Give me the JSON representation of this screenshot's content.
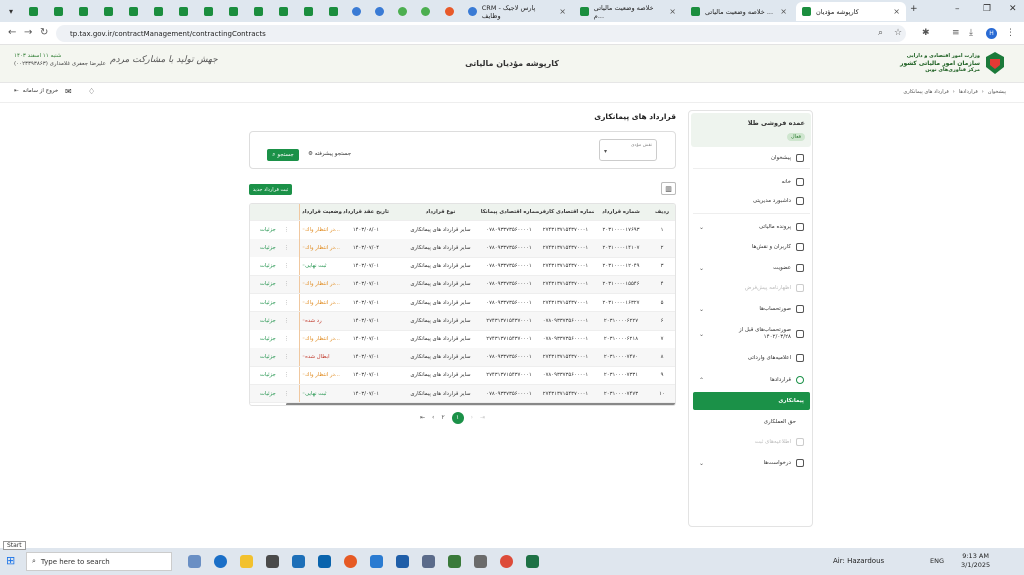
{
  "browser": {
    "tabs": [
      {
        "title": "CRM پارس لاجیک - وظایف",
        "icon": "task-icon"
      },
      {
        "title": "خلاصه وضعیت مالیاتی م...",
        "icon": "tax-icon"
      },
      {
        "title": "خلاصه وضعیت مالیاتی ...",
        "icon": "tax-icon"
      },
      {
        "title": "کارپوشه مؤدیان",
        "icon": "tax-icon",
        "active": true
      }
    ],
    "url": "tp.tax.gov.ir/contractManagement/contractingContracts",
    "profile": "H"
  },
  "header": {
    "title": "کارپوشه مؤدیان مالیاتی",
    "logo_line1": "وزارت امور اقتصادی و دارایی",
    "logo_line2": "سازمان امور مالیاتی کشور",
    "logo_line3": "مرکز فناوری‌های نوین",
    "slogan": "جهش تولید با مشارکت مردم",
    "date": "شنبه ۱۱ اسفند ۱۴۰۳",
    "user": "علیرضا جعفری غلامداری (۰۰۲۳۳۹۳۸۶۳)"
  },
  "toolbar": {
    "exit": "خروج از سامانه",
    "breadcrumb": [
      "پیشخوان",
      "قراردادها",
      "قرارداد های پیمانکاری"
    ]
  },
  "sidebar": {
    "company": "عمده فروشی طلا",
    "status": "فعال",
    "items": [
      {
        "label": "پیشخوان",
        "icon": "dashboard-icon"
      },
      {
        "label": "خانه",
        "icon": "home-icon"
      },
      {
        "label": "داشبورد مدیریتی",
        "icon": "chart-icon"
      },
      {
        "label": "پرونده مالیاتی",
        "icon": "folder-icon"
      },
      {
        "label": "کاربران و نقش‌ها",
        "icon": "users-icon"
      },
      {
        "label": "عضویت",
        "icon": "user-icon"
      },
      {
        "label": "اظهارنامه پیش‌فرض",
        "icon": "form-icon",
        "disabled": true
      },
      {
        "label": "صورتحساب‌ها",
        "icon": "invoice-icon"
      },
      {
        "label": "صورتحساب‌های قبل از ۱۴۰۲/۰۳/۲۸",
        "icon": "invoice-icon"
      },
      {
        "label": "اعلامیه‌های وارداتی",
        "icon": "doc-icon"
      },
      {
        "label": "قراردادها",
        "icon": "contract-icon"
      },
      {
        "label": "پیمانکاری",
        "icon": "",
        "selected": true
      },
      {
        "label": "حق العملکاری",
        "icon": ""
      },
      {
        "label": "اطلاعیه‌های ثبت",
        "icon": "bell-icon",
        "disabled": true
      },
      {
        "label": "درخواست‌ها",
        "icon": "request-icon"
      }
    ]
  },
  "main": {
    "title": "قرارداد های پیمانکاری",
    "field_label": "نقش مؤدی",
    "search_btn": "جستجو",
    "advanced": "جستجو پیشرفته",
    "new_btn": "ثبت قرارداد جدید",
    "columns": [
      "ردیف",
      "شماره قرارداد",
      "شماره اقتصادی کارفرما",
      "شماره اقتصادی پیمانکار",
      "نوع قرارداد",
      "تاریخ عقد قرارداد",
      "وضعیت قرارداد"
    ],
    "details": "جزئیات",
    "rows": [
      {
        "n": "۱",
        "cn": "۲۰۳۱۰۰۰۰۱۷۶۹۳",
        "sid": "۲۷۴۳۱۳۷۱۵۴۳۷۰۰۰۱",
        "eid": "۰۷۸۰۹۳۳۷۳۵۶۰۰۰۰۱",
        "type": "سایر قرارداد های پیمانکاری",
        "date": "۱۴۰۳/۰۸/۰۱",
        "status": "در انتظار واك...",
        "sc": "w"
      },
      {
        "n": "۲",
        "cn": "۲۰۳۱۰۰۰۰۱۴۱۰۷",
        "sid": "۲۷۴۳۱۳۷۱۵۴۳۷۰۰۰۱",
        "eid": "۰۷۸۰۹۳۳۷۳۵۶۰۰۰۰۱",
        "type": "سایر قرارداد های پیمانکاری",
        "date": "۱۴۰۳/۰۷/۰۴",
        "status": "در انتظار واك...",
        "sc": "w"
      },
      {
        "n": "۳",
        "cn": "۲۰۳۱۰۰۰۰۱۲۰۴۹",
        "sid": "۲۷۴۳۱۳۷۱۵۴۳۷۰۰۰۱",
        "eid": "۰۷۸۰۹۳۳۷۳۵۶۰۰۰۰۱",
        "type": "سایر قرارداد های پیمانکاری",
        "date": "۱۴۰۳/۰۷/۰۱",
        "status": "ثبت نهایی",
        "sc": "f"
      },
      {
        "n": "۴",
        "cn": "۲۰۳۱۰۰۰۰۱۵۵۴۶",
        "sid": "۲۷۴۳۱۳۷۱۵۴۳۷۰۰۰۱",
        "eid": "۰۷۸۰۹۳۳۷۳۵۶۰۰۰۰۱",
        "type": "سایر قرارداد های پیمانکاری",
        "date": "۱۴۰۳/۰۷/۰۱",
        "status": "در انتظار واك...",
        "sc": "w"
      },
      {
        "n": "۵",
        "cn": "۲۰۳۱۰۰۰۰۱۶۳۲۷",
        "sid": "۲۷۴۳۱۳۷۱۵۴۳۷۰۰۰۱",
        "eid": "۰۷۸۰۹۳۳۷۳۵۶۰۰۰۰۱",
        "type": "سایر قرارداد های پیمانکاری",
        "date": "۱۴۰۳/۰۷/۰۱",
        "status": "در انتظار واك...",
        "sc": "w"
      },
      {
        "n": "۶",
        "cn": "۲۰۳۱۰۰۰۰۶۲۲۷",
        "sid": "۰۷۸۰۹۳۳۷۳۵۶۰۰۰۰۱",
        "eid": "۲۷۴۳۱۳۷۱۵۴۳۷۰۰۰۱",
        "type": "سایر قرارداد های پیمانکاری",
        "date": "۱۴۰۳/۰۷/۰۱",
        "status": "رد شده",
        "sc": "x"
      },
      {
        "n": "۷",
        "cn": "۲۰۳۱۰۰۰۰۶۲۱۸",
        "sid": "۰۷۸۰۹۳۳۷۳۵۶۰۰۰۰۱",
        "eid": "۲۷۴۳۱۳۷۱۵۴۳۷۰۰۰۱",
        "type": "سایر قرارداد های پیمانکاری",
        "date": "۱۴۰۳/۰۷/۰۱",
        "status": "در انتظار واك...",
        "sc": "w"
      },
      {
        "n": "۸",
        "cn": "۲۰۳۱۰۰۰۰۷۴۷۰",
        "sid": "۲۷۴۳۱۳۷۱۵۴۳۷۰۰۰۱",
        "eid": "۰۷۸۰۹۳۳۷۳۵۶۰۰۰۰۱",
        "type": "سایر قرارداد های پیمانکاری",
        "date": "۱۴۰۳/۰۷/۰۱",
        "status": "ابطال شده",
        "sc": "x"
      },
      {
        "n": "۹",
        "cn": "۲۰۳۱۰۰۰۰۷۳۳۱",
        "sid": "۰۷۸۰۹۳۳۷۳۵۶۰۰۰۰۱",
        "eid": "۲۷۴۳۱۳۷۱۵۴۳۷۰۰۰۱",
        "type": "سایر قرارداد های پیمانکاری",
        "date": "۱۴۰۳/۰۷/۰۱",
        "status": "در انتظار واك...",
        "sc": "w"
      },
      {
        "n": "۱۰",
        "cn": "۲۰۳۱۰۰۰۰۷۴۷۳",
        "sid": "۲۷۴۳۱۳۷۱۵۴۳۷۰۰۰۱",
        "eid": "۰۷۸۰۹۳۳۷۳۵۶۰۰۰۰۱",
        "type": "سایر قرارداد های پیمانکاری",
        "date": "۱۴۰۳/۰۷/۰۱",
        "status": "ثبت نهایی",
        "sc": "f"
      }
    ],
    "pager": {
      "current": "۱",
      "next": "۲"
    }
  },
  "taskbar": {
    "start_tip": "Start",
    "search_placeholder": "Type here to search",
    "weather": "Air: Hazardous",
    "lang": "ENG",
    "time": "9:13 AM",
    "date": "3/1/2025"
  }
}
